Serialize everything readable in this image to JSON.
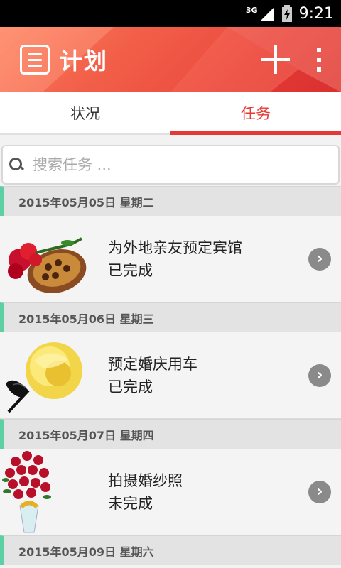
{
  "status_bar": {
    "network": "3G",
    "time": "9:21"
  },
  "app_bar": {
    "title": "计划",
    "icons": {
      "menu": "list-menu-icon",
      "add": "plus-icon",
      "more": "overflow-menu-icon"
    }
  },
  "tabs": [
    {
      "label": "状况",
      "active": false
    },
    {
      "label": "任务",
      "active": true
    }
  ],
  "search": {
    "placeholder": "搜索任务 ..."
  },
  "groups": [
    {
      "date": "2015年05月05日 星期二",
      "task": {
        "name": "为外地亲友预定宾馆",
        "status": "已完成",
        "image": "roses-chocolate-heart"
      }
    },
    {
      "date": "2015年05月06日 星期三",
      "task": {
        "name": "预定婚庆用车",
        "status": "已完成",
        "image": "gold-rose-feather"
      }
    },
    {
      "date": "2015年05月07日 星期四",
      "task": {
        "name": "拍摄婚纱照",
        "status": "未完成",
        "image": "rose-bouquet-vase"
      }
    },
    {
      "date": "2015年05月09日 星期六"
    }
  ],
  "colors": {
    "accent": "#e53935",
    "date_marker": "#5ccfa3"
  }
}
